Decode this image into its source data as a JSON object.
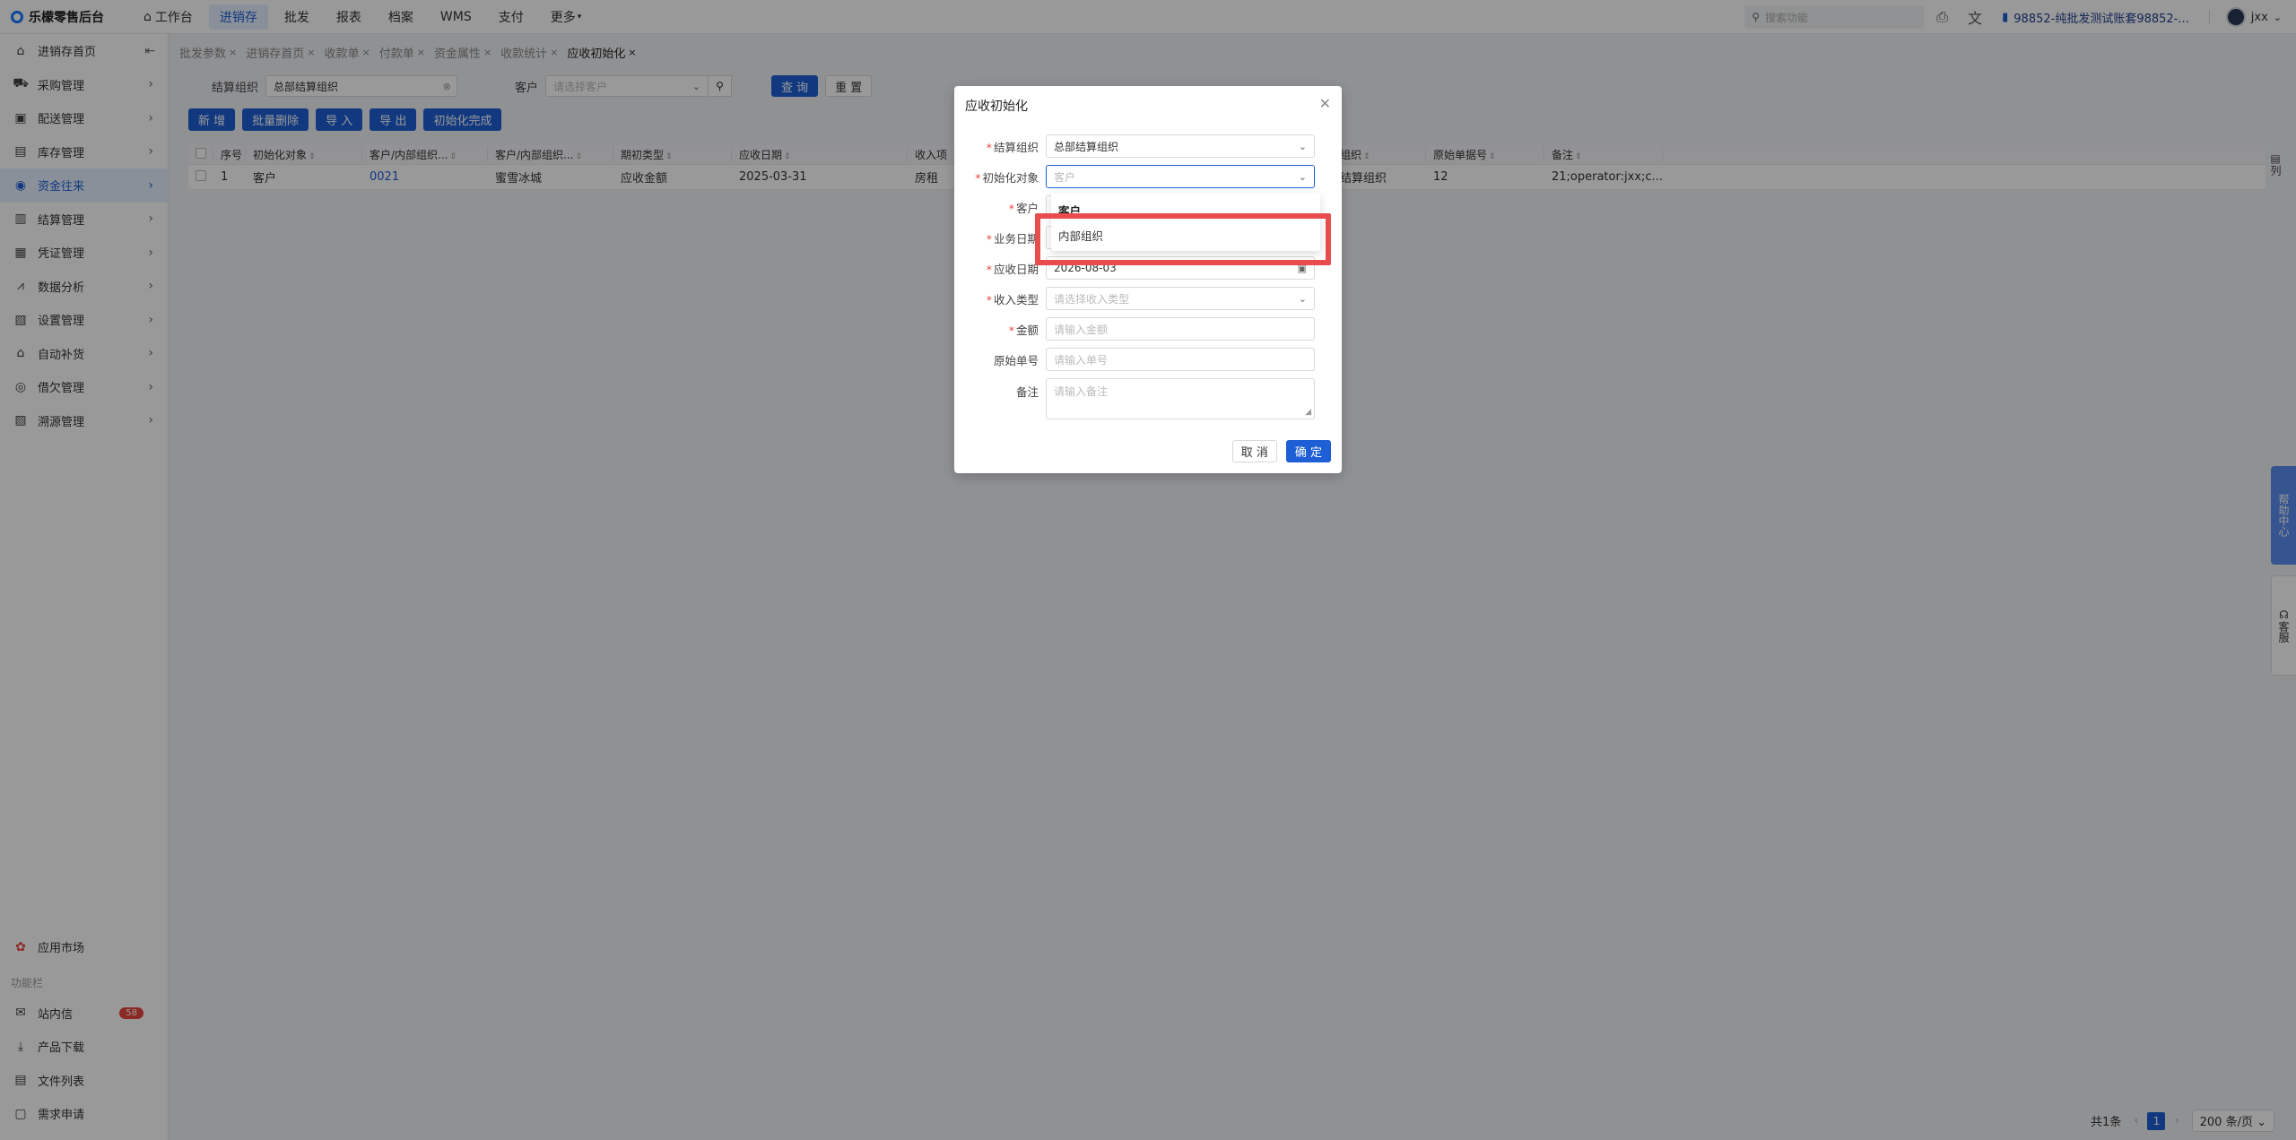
{
  "app": {
    "title": "乐檬零售后台"
  },
  "topnav": [
    {
      "label": "工作台",
      "icon": "home-icon"
    },
    {
      "label": "进销存",
      "active": true
    },
    {
      "label": "批发"
    },
    {
      "label": "报表"
    },
    {
      "label": "档案"
    },
    {
      "label": "WMS"
    },
    {
      "label": "支付"
    },
    {
      "label": "更多"
    }
  ],
  "topright": {
    "search_placeholder": "搜索功能",
    "account": "98852-纯批发测试账套98852-...",
    "user": "jxx"
  },
  "sidebar": {
    "items": [
      {
        "label": "进销存首页",
        "icon": "⌂"
      },
      {
        "label": "采购管理",
        "icon": "⛟"
      },
      {
        "label": "配送管理",
        "icon": "▣"
      },
      {
        "label": "库存管理",
        "icon": "▤"
      },
      {
        "label": "资金往来",
        "icon": "◉",
        "active": true
      },
      {
        "label": "结算管理",
        "icon": "▥"
      },
      {
        "label": "凭证管理",
        "icon": "▦"
      },
      {
        "label": "数据分析",
        "icon": "⩘"
      },
      {
        "label": "设置管理",
        "icon": "▧"
      },
      {
        "label": "自动补货",
        "icon": "⌂"
      },
      {
        "label": "借欠管理",
        "icon": "◎"
      },
      {
        "label": "溯源管理",
        "icon": "▨"
      }
    ],
    "app_market": "应用市场",
    "section_label": "功能栏",
    "bottom_items": [
      {
        "label": "站内信",
        "icon": "✉",
        "badge": "58"
      },
      {
        "label": "产品下载",
        "icon": "⤓"
      },
      {
        "label": "文件列表",
        "icon": "▤"
      },
      {
        "label": "需求申请",
        "icon": "▢"
      }
    ]
  },
  "tabs": [
    {
      "label": "批发参数"
    },
    {
      "label": "进销存首页"
    },
    {
      "label": "收款单"
    },
    {
      "label": "付款单"
    },
    {
      "label": "资金属性"
    },
    {
      "label": "收款统计"
    },
    {
      "label": "应收初始化",
      "active": true
    }
  ],
  "filters": {
    "org_label": "结算组织",
    "org_value": "总部结算组织",
    "customer_label": "客户",
    "customer_placeholder": "请选择客户",
    "query": "查 询",
    "reset": "重 置"
  },
  "actions": [
    "新 增",
    "批量删除",
    "导 入",
    "导 出",
    "初始化完成"
  ],
  "table": {
    "headers": [
      "序号",
      "初始化对象",
      "客户/内部组织...",
      "客户/内部组织...",
      "期初类型",
      "应收日期",
      "收入项",
      "组织",
      "原始单据号",
      "备注"
    ],
    "rows": [
      [
        "1",
        "客户",
        "0021",
        "蜜雪冰城",
        "应收金额",
        "2025-03-31",
        "房租",
        "结算组织",
        "12",
        "21;operator:jxx;c..."
      ]
    ]
  },
  "column_setting": "列",
  "pager": {
    "total": "共1条",
    "page": "1",
    "size": "200 条/页"
  },
  "floaters": {
    "help": "帮助中心",
    "service": "客服"
  },
  "modal": {
    "title": "应收初始化",
    "fields": [
      {
        "label": "结算组织",
        "required": true,
        "value": "总部结算组织",
        "type": "select"
      },
      {
        "label": "初始化对象",
        "required": true,
        "placeholder": "客户",
        "type": "select"
      },
      {
        "label": "客户",
        "required": true,
        "type": "select"
      },
      {
        "label": "业务日期",
        "required": true,
        "type": "date"
      },
      {
        "label": "应收日期",
        "required": true,
        "value": "2026-08-03",
        "type": "date"
      },
      {
        "label": "收入类型",
        "required": true,
        "placeholder": "请选择收入类型",
        "type": "select"
      },
      {
        "label": "金额",
        "required": true,
        "placeholder": "请输入金额",
        "type": "input"
      },
      {
        "label": "原始单号",
        "required": false,
        "placeholder": "请输入单号",
        "type": "input"
      },
      {
        "label": "备注",
        "required": false,
        "placeholder": "请输入备注",
        "type": "textarea"
      }
    ],
    "dropdown_options": [
      "客户",
      "内部组织"
    ],
    "cancel": "取 消",
    "confirm": "确 定"
  }
}
